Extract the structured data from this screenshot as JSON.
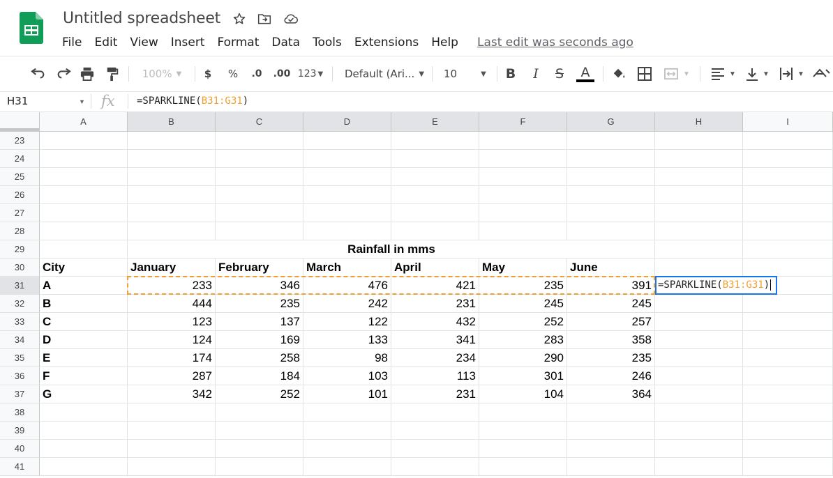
{
  "doc": {
    "title": "Untitled spreadsheet",
    "last_edit": "Last edit was seconds ago"
  },
  "menu": [
    "File",
    "Edit",
    "View",
    "Insert",
    "Format",
    "Data",
    "Tools",
    "Extensions",
    "Help"
  ],
  "toolbar": {
    "zoom": "100%",
    "currency": "$",
    "percent": "%",
    "decrease_decimal": ".0",
    "increase_decimal": ".00",
    "more_formats": "123",
    "font_family": "Default (Ari...",
    "font_size": "10",
    "bold": "B",
    "italic": "I",
    "strike": "S",
    "text_color": "A"
  },
  "formula_bar": {
    "name_box": "H31",
    "fx": "fx",
    "formula_prefix": "=SPARKLINE(",
    "formula_ref": "B31:G31",
    "formula_suffix": ")"
  },
  "columns": [
    "A",
    "B",
    "C",
    "D",
    "E",
    "F",
    "G",
    "H",
    "I"
  ],
  "rows": [
    "23",
    "24",
    "25",
    "26",
    "27",
    "28",
    "29",
    "30",
    "31",
    "32",
    "33",
    "34",
    "35",
    "36",
    "37",
    "38",
    "39",
    "40",
    "41"
  ],
  "sheet": {
    "title": "Rainfall in mms",
    "header": [
      "City",
      "January",
      "February",
      "March",
      "April",
      "May",
      "June"
    ],
    "data": [
      [
        "A",
        "233",
        "346",
        "476",
        "421",
        "235",
        "391"
      ],
      [
        "B",
        "444",
        "235",
        "242",
        "231",
        "245",
        "245"
      ],
      [
        "C",
        "123",
        "137",
        "122",
        "432",
        "252",
        "257"
      ],
      [
        "D",
        "124",
        "169",
        "133",
        "341",
        "283",
        "358"
      ],
      [
        "E",
        "174",
        "258",
        "98",
        "234",
        "290",
        "235"
      ],
      [
        "F",
        "287",
        "184",
        "103",
        "113",
        "301",
        "246"
      ],
      [
        "G",
        "342",
        "252",
        "101",
        "231",
        "104",
        "364"
      ]
    ]
  },
  "active_cell": {
    "prefix": "=SPARKLINE(",
    "ref": "B31:G31",
    "suffix": ")"
  },
  "colors": {
    "accent": "#1a73e8",
    "copy_range": "#f0a030",
    "logo": "#0f9d58"
  }
}
